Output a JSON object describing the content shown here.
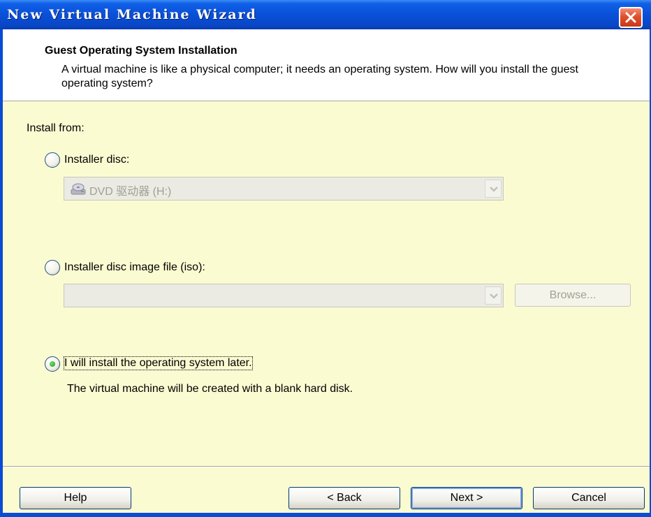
{
  "window": {
    "title": "New Virtual Machine Wizard"
  },
  "header": {
    "title": "Guest Operating System Installation",
    "description": "A virtual machine is like a physical computer; it needs an operating system. How will you install the guest operating system?"
  },
  "install_from": {
    "label": "Install from:",
    "options": [
      {
        "label": "Installer disc:",
        "selected": false
      },
      {
        "label": "Installer disc image file (iso):",
        "selected": false
      },
      {
        "label": "I will install the operating system later.",
        "selected": true
      }
    ],
    "disc_combo": {
      "value": "DVD 驱动器 (H:)",
      "icon": "dvd-drive-icon",
      "enabled": false
    },
    "iso_combo": {
      "value": "",
      "enabled": false
    },
    "browse_button": {
      "label": "Browse...",
      "enabled": false
    },
    "later_note": "The virtual machine will be created with a blank hard disk."
  },
  "footer": {
    "help": "Help",
    "back": "< Back",
    "next": "Next >",
    "cancel": "Cancel"
  },
  "colors": {
    "title_bar": "#0a50d8",
    "body_background": "#fbfbd2",
    "header_background": "#ffffff",
    "close_button": "#e0502c"
  }
}
